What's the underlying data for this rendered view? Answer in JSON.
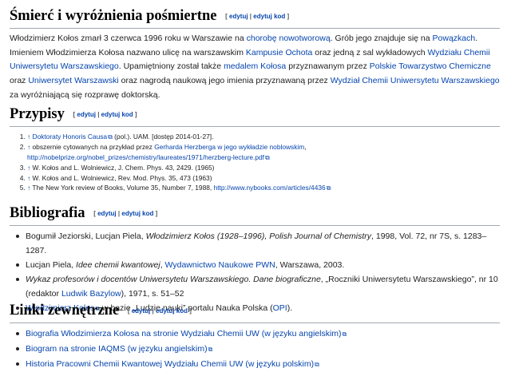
{
  "edit_labels": {
    "edit": "edytuj",
    "sep": "|",
    "edit_code": "edytuj kod",
    "open": "[",
    "close": "]"
  },
  "s1": {
    "title": "Śmierć i wyróżnienia pośmiertne",
    "p": [
      {
        "t": "Włodzimierz Kołos zmarł 3 czerwca 1996 roku w Warszawie na "
      },
      {
        "l": "chorobę nowotworową"
      },
      {
        "t": ". Grób jego znajduje się na "
      },
      {
        "l": "Powązkach"
      },
      {
        "t": ". Imieniem Włodzimierza Kołosa nazwano ulicę na warszawskim "
      },
      {
        "l": "Kampusie Ochota"
      },
      {
        "t": " oraz jedną z sal wykładowych "
      },
      {
        "l": "Wydziału Chemii Uniwersytetu Warszawskiego"
      },
      {
        "t": ". Upamiętniony został także "
      },
      {
        "l": "medalem Kołosa"
      },
      {
        "t": " przyznawanym przez "
      },
      {
        "l": "Polskie Towarzystwo Chemiczne"
      },
      {
        "t": " oraz "
      },
      {
        "l": "Uniwersytet Warszawski"
      },
      {
        "t": " oraz nagrodą naukową jego imienia przyznawaną przez "
      },
      {
        "l": "Wydział Chemii Uniwersytetu Warszawskiego"
      },
      {
        "t": " za wyróżniającą się rozprawę doktorską."
      }
    ]
  },
  "s2": {
    "title": "Przypisy",
    "refs": [
      [
        {
          "t": "↑ ",
          "c": "up"
        },
        {
          "l": "Doktoraty Honoris Causa"
        },
        {
          "e": "⧉"
        },
        {
          "t": " (pol.). UAM. [dostęp 2014-01-27]."
        }
      ],
      [
        {
          "t": "↑ ",
          "c": "up"
        },
        {
          "t": "obszernie cytowanych na przykład przez "
        },
        {
          "l": "Gerharda Herzberga w jego wykładzie noblowskim"
        },
        {
          "t": ", "
        },
        {
          "l": "http://nobelprize.org/nobel_prizes/chemistry/laureates/1971/herzberg-lecture.pdf"
        },
        {
          "e": "⧉"
        }
      ],
      [
        {
          "t": "↑ ",
          "c": "up"
        },
        {
          "t": "W. Kołos and L. Wolniewicz, J. Chem. Phys. 43, 2429. (1965)"
        }
      ],
      [
        {
          "t": "↑ ",
          "c": "up"
        },
        {
          "t": "W. Kołos and L. Wolniewicz, Rev. Mod. Phys. 35, 473 (1963)"
        }
      ],
      [
        {
          "t": "↑ ",
          "c": "up"
        },
        {
          "t": "The New York review of Books, Volume 35, Number 7, 1988, "
        },
        {
          "l": "http://www.nybooks.com/articles/4436"
        },
        {
          "e": "⧉"
        }
      ]
    ]
  },
  "s3": {
    "title": "Bibliografia",
    "items": [
      [
        {
          "t": "Bogumił Jeziorski, Lucjan Piela, "
        },
        {
          "i": "Włodzimierz Kołos (1928–1996), Polish Journal of Chemistry"
        },
        {
          "t": ", 1998, Vol. 72, nr 7S, s. 1283–1287."
        }
      ],
      [
        {
          "t": "Lucjan Piela, "
        },
        {
          "i": "Idee chemii kwantowej"
        },
        {
          "t": ", "
        },
        {
          "l": "Wydawnictwo Naukowe PWN"
        },
        {
          "t": ", Warszawa, 2003."
        }
      ],
      [
        {
          "i": "Wykaz profesorów i docentów Uniwersytetu Warszawskiego. Dane biograficzne"
        },
        {
          "t": ", „Roczniki Uniwersytetu Warszawskiego”, nr 10 (redaktor "
        },
        {
          "l": "Ludwik Bazylow"
        },
        {
          "t": "), 1971, s. 51–52"
        }
      ],
      [
        {
          "l": "Włodzimierz Kołos"
        },
        {
          "e": "⧉"
        },
        {
          "t": " w bazie „Ludzie nauki” portalu Nauka Polska ("
        },
        {
          "l": "OPI"
        },
        {
          "t": ")."
        }
      ]
    ]
  },
  "s4": {
    "title": "Linki zewnętrzne",
    "items": [
      [
        {
          "l": "Biografia Włodzimierza Kołosa na stronie Wydziału Chemii UW (w języku angielskim)"
        },
        {
          "e": "⧉"
        }
      ],
      [
        {
          "l": "Biogram na stronie IAQMS (w języku angielskim)"
        },
        {
          "e": "⧉"
        }
      ],
      [
        {
          "l": "Historia Pracowni Chemii Kwantowej Wydziału Chemii UW (w języku polskim)"
        },
        {
          "e": "⧉"
        }
      ]
    ]
  }
}
